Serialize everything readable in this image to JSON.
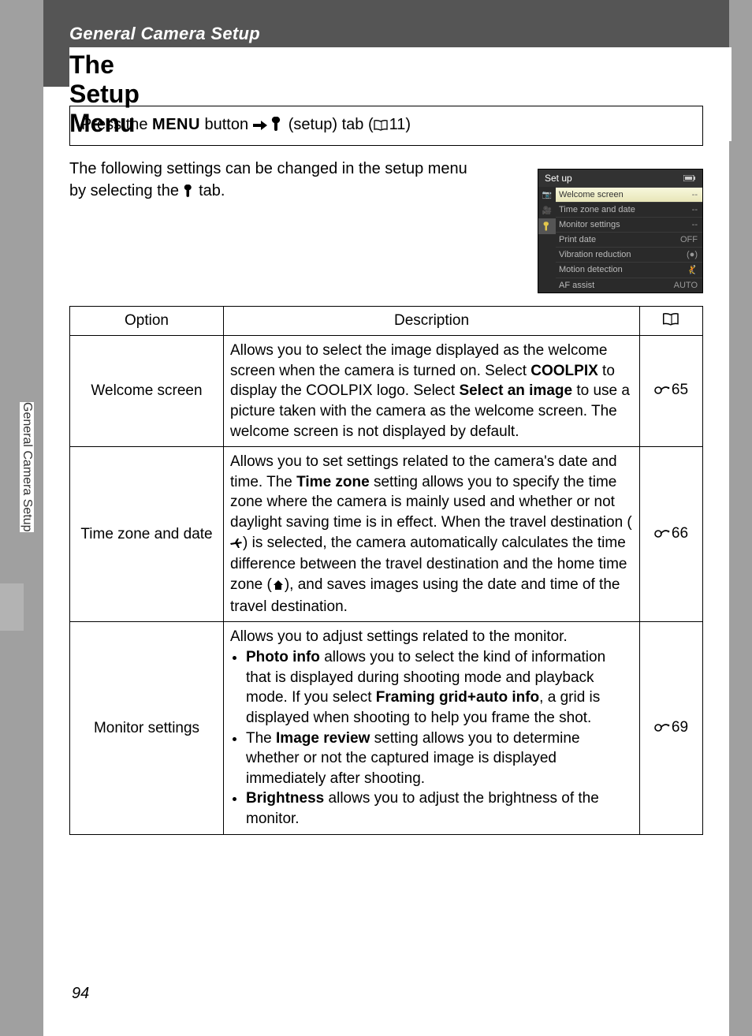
{
  "header": {
    "section_label": "General Camera Setup",
    "title": "The Setup Menu"
  },
  "nav_box": {
    "prefix": "Press the ",
    "menu_label": "MENU",
    "mid": " button ",
    "after_arrow_pre": " ",
    "setup_tab": " (setup) tab (",
    "page_ref": "11)",
    "book_icon_label": "reference-icon"
  },
  "intro": {
    "line1": "The following settings can be changed in the setup menu by selecting the ",
    "line2_suffix": " tab."
  },
  "setup_screenshot": {
    "title": "Set up",
    "battery_icon": "battery-icon",
    "items": [
      {
        "label": "Welcome screen",
        "value": "--",
        "selected": true
      },
      {
        "label": "Time zone and date",
        "value": "--",
        "selected": false
      },
      {
        "label": "Monitor settings",
        "value": "--",
        "selected": false
      },
      {
        "label": "Print date",
        "value": "OFF",
        "selected": false
      },
      {
        "label": "Vibration reduction",
        "value": "(●)",
        "selected": false
      },
      {
        "label": "Motion detection",
        "value": "🤾",
        "selected": false
      },
      {
        "label": "AF assist",
        "value": "AUTO",
        "selected": false
      }
    ]
  },
  "table": {
    "headers": {
      "option": "Option",
      "description": "Description",
      "ref_icon": "book-icon"
    },
    "rows": [
      {
        "option": "Welcome screen",
        "desc_parts": {
          "p1": "Allows you to select the image displayed as the welcome screen when the camera is turned on. Select ",
          "b1": "COOLPIX",
          "p2": " to display the COOLPIX logo. Select ",
          "b2": "Select an image",
          "p3": " to use a picture taken with the camera as the welcome screen. The welcome screen is not displayed by default."
        },
        "ref": "65"
      },
      {
        "option": "Time zone and date",
        "desc_parts": {
          "p1": "Allows you to set settings related to the camera's date and time. The ",
          "b1": "Time zone",
          "p2": " setting allows you to specify the time zone where the camera is mainly used and whether or not daylight saving time is in effect. When the travel destination (",
          "icon1": "plane-icon",
          "p3": ") is selected, the camera automatically calculates the time difference between the travel destination and the home time zone (",
          "icon2": "home-icon",
          "p4": "), and saves images using the date and time of the travel destination."
        },
        "ref": "66"
      },
      {
        "option": "Monitor settings",
        "desc_parts": {
          "p1": "Allows you to adjust settings related to the monitor.",
          "bullets": [
            {
              "b": "Photo info",
              "t": " allows you to select the kind of information that is displayed during shooting mode and playback mode. If you select ",
              "b2": "Framing grid+auto info",
              "t2": ", a grid is displayed when shooting to help you frame the shot."
            },
            {
              "pre": "The ",
              "b": "Image review",
              "t": " setting allows you to determine whether or not the captured image is displayed immediately after shooting."
            },
            {
              "b": "Brightness",
              "t": " allows you to adjust the brightness of the monitor."
            }
          ]
        },
        "ref": "69"
      }
    ]
  },
  "side_tab": "General Camera Setup",
  "page_number": "94"
}
